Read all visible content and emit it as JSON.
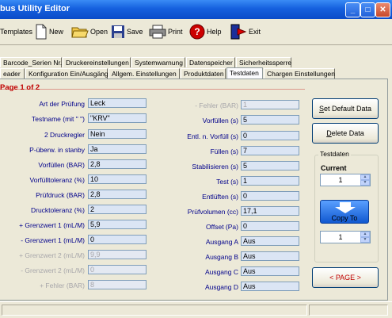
{
  "window": {
    "title": "bus Utility Editor",
    "min": "_",
    "max": "□",
    "close": "✕"
  },
  "toolbar": {
    "templates": "Templates",
    "new": "New",
    "open": "Open",
    "save": "Save",
    "print": "Print",
    "help": "Help",
    "exit": "Exit"
  },
  "tabs_row1": [
    "Barcode_Serien Nr.",
    "Druckereinstellungen",
    "Systemwarnung",
    "Datenspeicher",
    "Sicherheitssperre"
  ],
  "tabs_row2": [
    "eader",
    "Konfiguration Ein/Ausgänge",
    "Allgem. Einstellungen",
    "Produktdaten",
    "Testdaten",
    "Chargen Einstellungen"
  ],
  "page_label": "Page 1 of 2",
  "left_fields": [
    {
      "label": "Art der Prüfung",
      "value": "Leck",
      "disabled": false
    },
    {
      "label": "Testname (mit \" \")",
      "value": "\"KRV\"",
      "disabled": false
    },
    {
      "label": "2 Druckregler",
      "value": "Nein",
      "disabled": false
    },
    {
      "label": "P-überw. in stanby",
      "value": "Ja",
      "disabled": false
    },
    {
      "label": "Vorfüllen (BAR)",
      "value": "2,8",
      "disabled": false
    },
    {
      "label": "Vorfülltoleranz (%)",
      "value": "10",
      "disabled": false
    },
    {
      "label": "Prüfdruck (BAR)",
      "value": "2,8",
      "disabled": false
    },
    {
      "label": "Drucktoleranz (%)",
      "value": "2",
      "disabled": false
    },
    {
      "label": "+ Grenzwert 1 (mL/M)",
      "value": "5,9",
      "disabled": false
    },
    {
      "label": "- Grenzwert 1 (mL/M)",
      "value": "0",
      "disabled": false
    },
    {
      "label": "+ Grenzwert 2 (mL/M)",
      "value": "9,9",
      "disabled": true
    },
    {
      "label": "- Grenzwert 2 (mL/M)",
      "value": "0",
      "disabled": true
    },
    {
      "label": "+ Fehler (BAR)",
      "value": "8",
      "disabled": true
    }
  ],
  "right_fields": [
    {
      "label": "- Fehler (BAR)",
      "value": "1",
      "disabled": true
    },
    {
      "label": "Vorfüllen (s)",
      "value": "5",
      "disabled": false
    },
    {
      "label": "Entl. n. Vorfüll (s)",
      "value": "0",
      "disabled": false
    },
    {
      "label": "Füllen (s)",
      "value": "7",
      "disabled": false
    },
    {
      "label": "Stabilisieren (s)",
      "value": "5",
      "disabled": false
    },
    {
      "label": "Test (s)",
      "value": "1",
      "disabled": false
    },
    {
      "label": "Entlüften (s)",
      "value": "0",
      "disabled": false
    },
    {
      "label": "Prüfvolumen (cc)",
      "value": "17,1",
      "disabled": false
    },
    {
      "label": "Offset (Pa)",
      "value": "0",
      "disabled": false
    },
    {
      "label": "Ausgang A",
      "value": "Aus",
      "disabled": false
    },
    {
      "label": "Ausgang B",
      "value": "Aus",
      "disabled": false
    },
    {
      "label": "Ausgang C",
      "value": "Aus",
      "disabled": false
    },
    {
      "label": "Ausgang D",
      "value": "Aus",
      "disabled": false
    }
  ],
  "buttons": {
    "set_default_pre": "S",
    "set_default_rest": "et Default Data",
    "delete_pre": "D",
    "delete_rest": "elete Data",
    "copy_to": "Copy To",
    "page_nav": "< PAGE >"
  },
  "testdaten": {
    "group_title": "Testdaten",
    "current_label": "Current",
    "current_value": "1",
    "copy_target_value": "1"
  }
}
